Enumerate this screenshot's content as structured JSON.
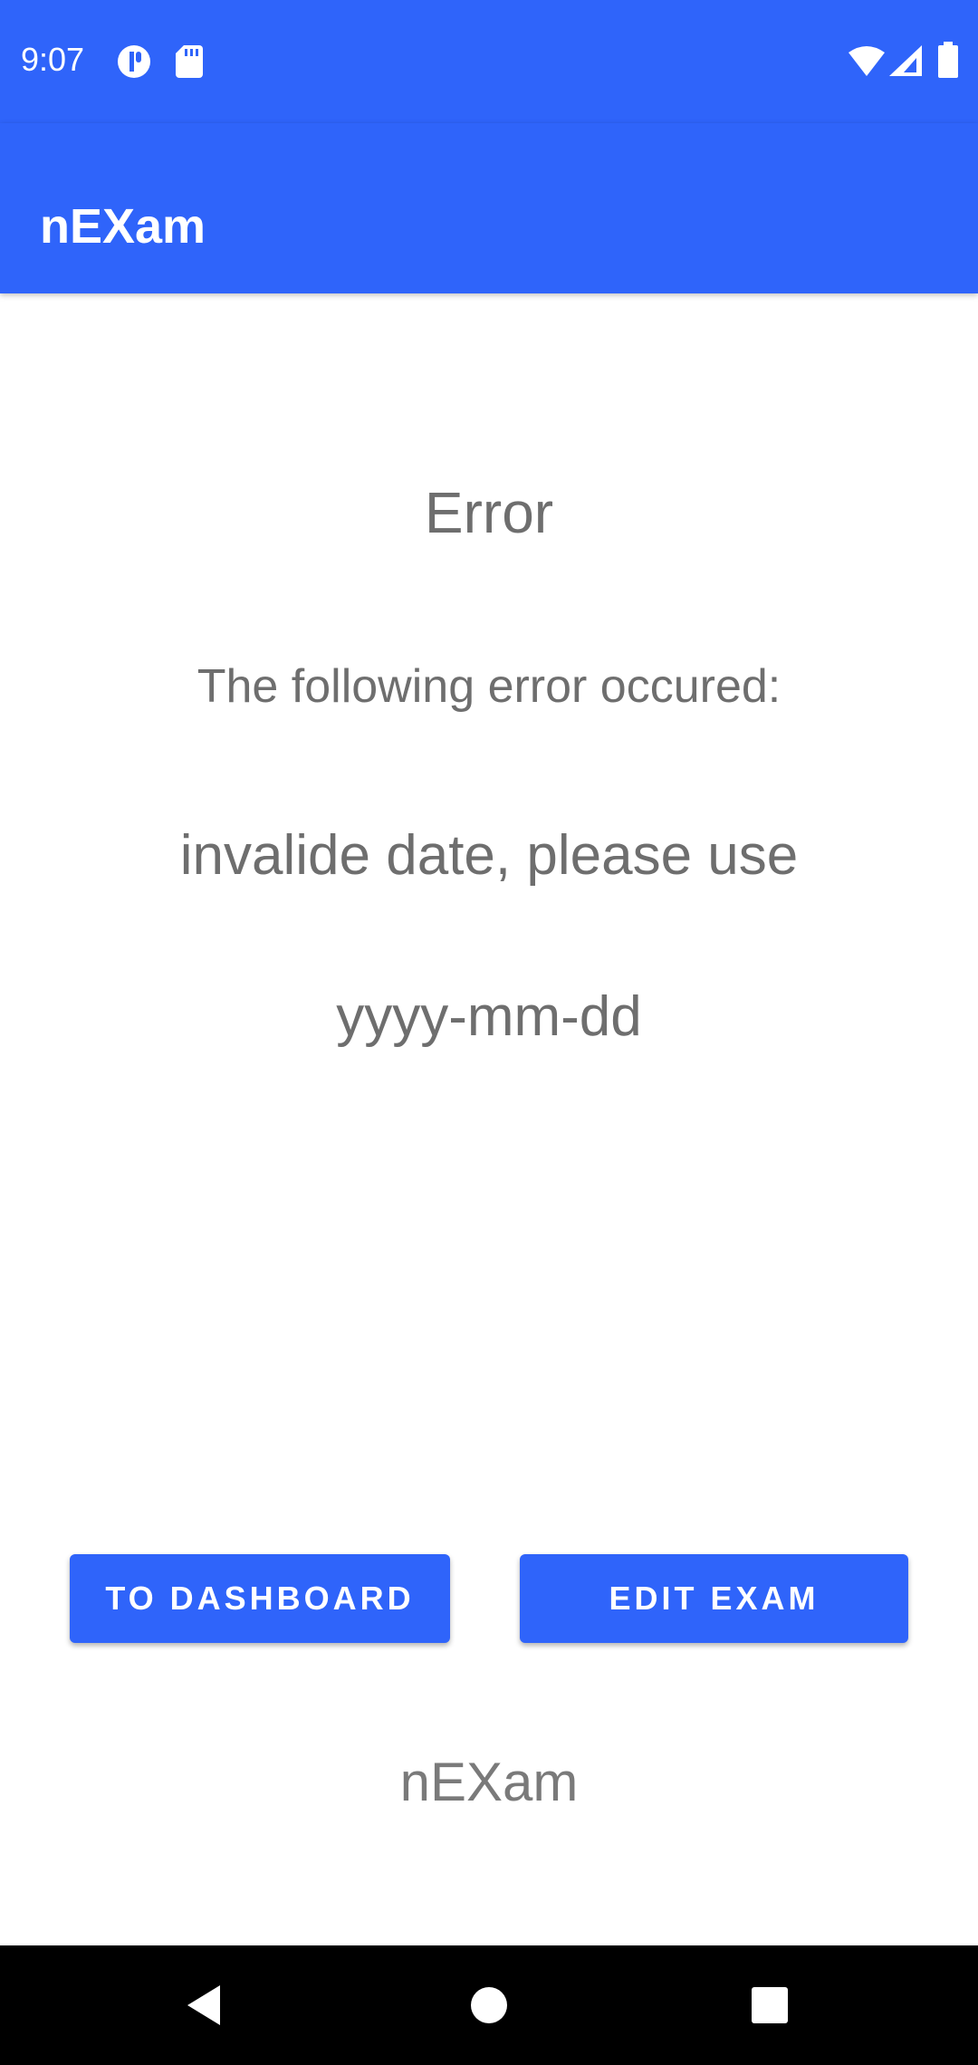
{
  "status_bar": {
    "time": "9:07",
    "icons": [
      "privacy-indicator-icon",
      "sd-card-icon",
      "wifi-icon",
      "cell-signal-icon",
      "battery-icon"
    ]
  },
  "app_bar": {
    "title": "nEXam"
  },
  "error": {
    "title": "Error",
    "intro": "The following error occured:",
    "message": "invalide date, please use",
    "format": "yyyy-mm-dd"
  },
  "actions": {
    "dashboard_label": "TO DASHBOARD",
    "edit_label": "EDIT EXAM"
  },
  "footer": {
    "brand": "nEXam"
  },
  "nav_bar": {
    "icons": [
      "back-icon",
      "home-icon",
      "recents-icon"
    ]
  },
  "colors": {
    "primary": "#2f64fa",
    "text_secondary": "#6e6e6e",
    "nav_background": "#000000"
  }
}
